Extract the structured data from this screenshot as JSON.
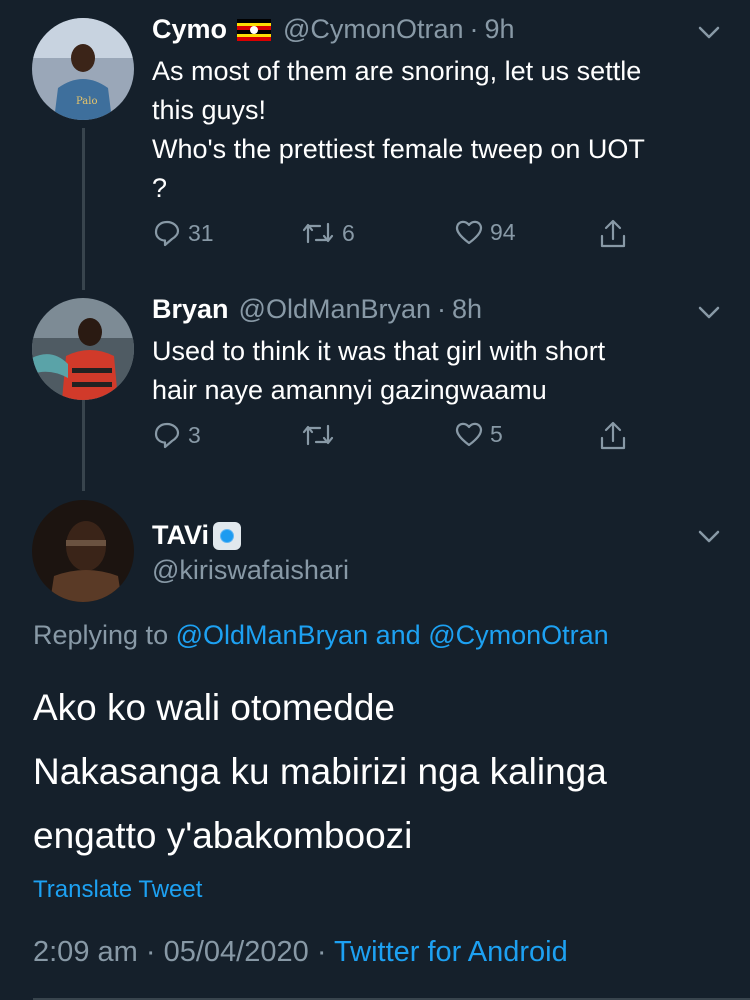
{
  "tweets": [
    {
      "name": "Cymo",
      "flag": "uganda-flag",
      "handle": "@CymonOtran",
      "time": "9h",
      "lines": [
        "As most of them are snoring, let us settle",
        "this guys!",
        "Who's the prettiest female tweep on UOT",
        "?"
      ],
      "replies": "31",
      "retweets": "6",
      "likes": "94"
    },
    {
      "name": "Bryan",
      "handle": "@OldManBryan",
      "time": "8h",
      "lines": [
        "Used to think it was that girl with short",
        "hair naye amannyi gazingwaamu"
      ],
      "replies": "3",
      "retweets": "",
      "likes": "5"
    }
  ],
  "main": {
    "name": "TAVi",
    "handle": "@kiriswafaishari",
    "replying_prefix": "Replying to",
    "replying_user1": "@OldManBryan",
    "replying_and": "and",
    "replying_user2": "@CymonOtran",
    "lines": [
      "Ako ko wali otomedde",
      "Nakasanga ku mabirizi nga kalinga",
      "engatto y'abakomboozi"
    ],
    "translate": "Translate Tweet",
    "time": "2:09 am",
    "date": "05/04/2020",
    "source": "Twitter for Android",
    "sep": "·"
  },
  "colors": {
    "background": "#15202b",
    "secondary_text": "#8899a6",
    "link": "#1da1f2",
    "thread_line": "#38444d"
  },
  "icons": [
    "reply-icon",
    "retweet-icon",
    "like-icon",
    "share-icon",
    "chevron-down-icon",
    "verified-badge-icon"
  ]
}
